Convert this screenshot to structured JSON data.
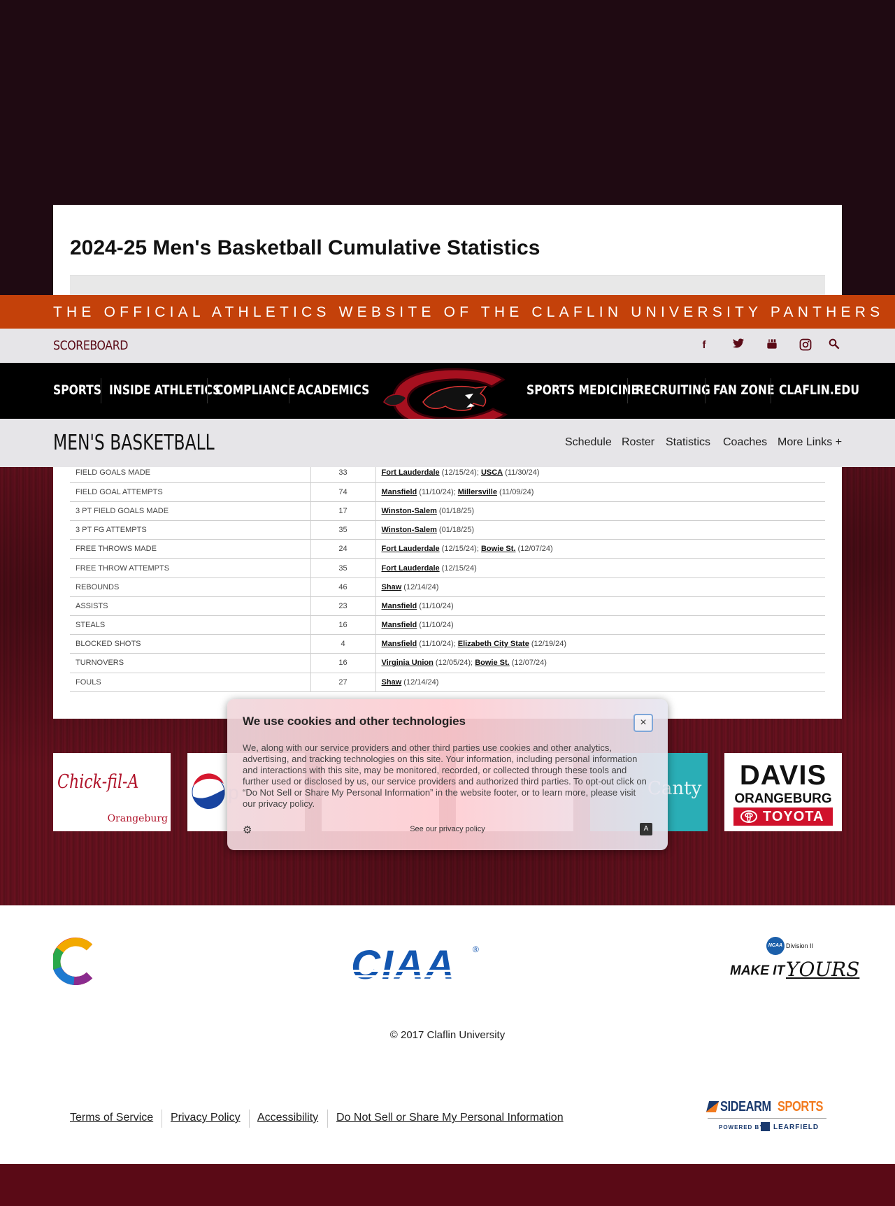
{
  "page": {
    "title": "2024-25 Men's Basketball Cumulative Statistics"
  },
  "banner": {
    "text": "THE OFFICIAL ATHLETICS WEBSITE OF THE CLAFLIN UNIVERSITY PANTHERS"
  },
  "util_bar": {
    "scoreboard": "SCOREBOARD",
    "icons": [
      "facebook-icon",
      "twitter-icon",
      "youtube-icon",
      "instagram-icon",
      "search-icon"
    ]
  },
  "main_nav": {
    "left": [
      "SPORTS",
      "INSIDE ATHLETICS",
      "COMPLIANCE",
      "ACADEMICS"
    ],
    "right": [
      "SPORTS MEDICINE",
      "RECRUITING",
      "FAN ZONE",
      "CLAFLIN.EDU"
    ]
  },
  "sport_bar": {
    "name": "MEN'S BASKETBALL",
    "links": [
      "Schedule",
      "Roster",
      "Statistics",
      "Coaches",
      "More Links +"
    ]
  },
  "stats_rows": [
    {
      "label": "FIELD GOALS MADE",
      "value": "33",
      "games": [
        {
          "opp": "Fort Lauderdale",
          "date": " (12/15/24); "
        },
        {
          "opp": "USCA",
          "date": " (11/30/24)"
        }
      ]
    },
    {
      "label": "FIELD GOAL ATTEMPTS",
      "value": "74",
      "games": [
        {
          "opp": "Mansfield",
          "date": " (11/10/24); "
        },
        {
          "opp": "Millersville",
          "date": " (11/09/24)"
        }
      ]
    },
    {
      "label": "3 PT FIELD GOALS MADE",
      "value": "17",
      "games": [
        {
          "opp": "Winston-Salem",
          "date": " (01/18/25)"
        }
      ]
    },
    {
      "label": "3 PT FG ATTEMPTS",
      "value": "35",
      "games": [
        {
          "opp": "Winston-Salem",
          "date": " (01/18/25)"
        }
      ]
    },
    {
      "label": "FREE THROWS MADE",
      "value": "24",
      "games": [
        {
          "opp": "Fort Lauderdale",
          "date": " (12/15/24); "
        },
        {
          "opp": "Bowie St.",
          "date": " (12/07/24)"
        }
      ]
    },
    {
      "label": "FREE THROW ATTEMPTS",
      "value": "35",
      "games": [
        {
          "opp": "Fort Lauderdale",
          "date": " (12/15/24)"
        }
      ]
    },
    {
      "label": "REBOUNDS",
      "value": "46",
      "games": [
        {
          "opp": "Shaw",
          "date": " (12/14/24)"
        }
      ]
    },
    {
      "label": "ASSISTS",
      "value": "23",
      "games": [
        {
          "opp": "Mansfield",
          "date": " (11/10/24)"
        }
      ]
    },
    {
      "label": "STEALS",
      "value": "16",
      "games": [
        {
          "opp": "Mansfield",
          "date": " (11/10/24)"
        }
      ]
    },
    {
      "label": "BLOCKED SHOTS",
      "value": "4",
      "games": [
        {
          "opp": "Mansfield",
          "date": " (11/10/24); "
        },
        {
          "opp": "Elizabeth City State",
          "date": " (12/19/24)"
        }
      ]
    },
    {
      "label": "TURNOVERS",
      "value": "16",
      "games": [
        {
          "opp": "Virginia Union",
          "date": " (12/05/24); "
        },
        {
          "opp": "Bowie St.",
          "date": " (12/07/24)"
        }
      ]
    },
    {
      "label": "FOULS",
      "value": "27",
      "games": [
        {
          "opp": "Shaw",
          "date": " (12/14/24)"
        }
      ]
    }
  ],
  "sponsors": {
    "chickfila": {
      "name": "Chick-fil-A",
      "sub": "Orangeburg"
    },
    "canty": "Canty",
    "davis": {
      "line1": "DAVIS",
      "line2": "ORANGEBURG",
      "line3": "TOYOTA"
    }
  },
  "cookie": {
    "title": "We use cookies and other technologies",
    "body": "We, along with our service providers and other third parties use cookies and other analytics, advertising, and tracking technologies on this site. Your information, including personal information and interactions with this site, may be monitored, recorded, or collected through these tools and further used or disclosed by us, our service providers and authorized third parties. To opt-out click on “Do Not Sell or Share My Personal Information” in the website footer, or to learn more, please visit our privacy policy.",
    "privacy_link": "See our privacy policy",
    "close": "×"
  },
  "footer": {
    "ciaa": "CIAA",
    "ncaa_division": "Division II",
    "ncaa_slogan_a": "MAKE IT",
    "ncaa_slogan_b": "YOURS",
    "copyright": "© 2017 Claflin University",
    "links": [
      "Terms of Service",
      "Privacy Policy",
      "Accessibility",
      "Do Not Sell or Share My Personal Information"
    ],
    "sidearm": {
      "a": "SIDEARM",
      "b": "SPORTS",
      "powered": "POWERED BY",
      "learfield": "LEARFIELD"
    }
  },
  "colors": {
    "banner": "#c4410a",
    "maroon": "#5a0a16",
    "nav_bg": "#000000",
    "sport_bar_bg": "#e6e5e8"
  }
}
